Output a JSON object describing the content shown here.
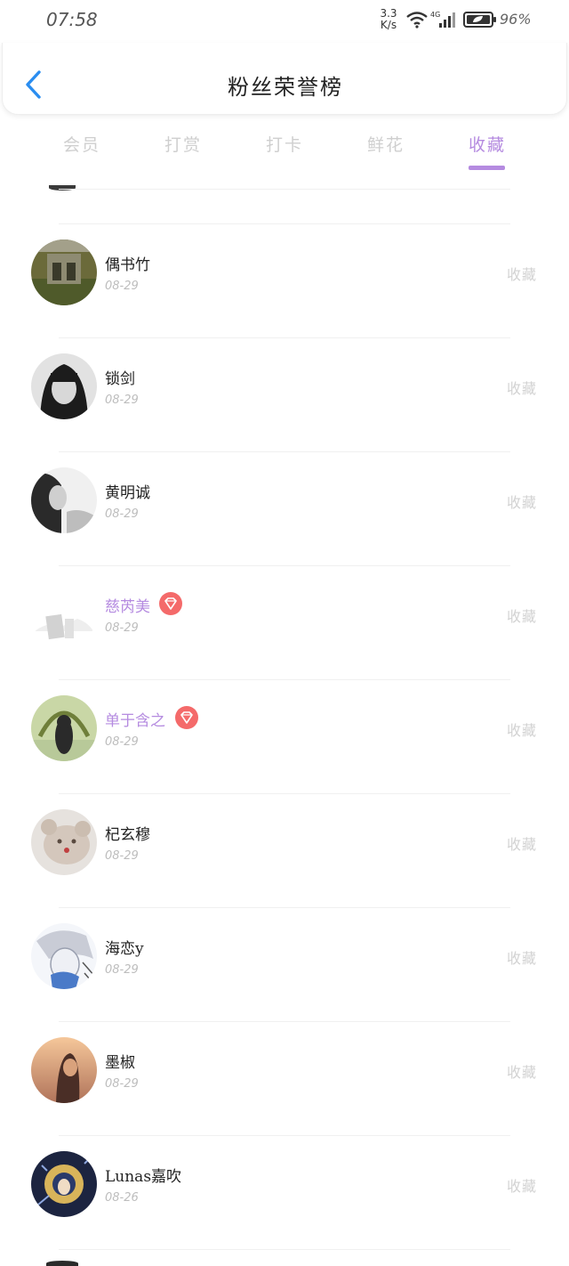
{
  "status": {
    "time": "07:58",
    "net_speed_value": "3.3",
    "net_speed_unit": "K/s",
    "battery": "96%"
  },
  "header": {
    "title": "粉丝荣誉榜"
  },
  "tabs": [
    {
      "label": "会员"
    },
    {
      "label": "打赏"
    },
    {
      "label": "打卡"
    },
    {
      "label": "鲜花"
    },
    {
      "label": "收藏"
    }
  ],
  "active_tab": "收藏",
  "colors": {
    "accent": "#b58be0",
    "back": "#2a8df0",
    "badge": "#f46a6a",
    "muted": "#d2d2d2"
  },
  "rows": [
    {
      "name": "偶书竹",
      "date": "08-29",
      "action": "收藏",
      "vip": false
    },
    {
      "name": "锁剑",
      "date": "08-29",
      "action": "收藏",
      "vip": false
    },
    {
      "name": "黄明诚",
      "date": "08-29",
      "action": "收藏",
      "vip": false
    },
    {
      "name": "慈芮美",
      "date": "08-29",
      "action": "收藏",
      "vip": true
    },
    {
      "name": "单于含之",
      "date": "08-29",
      "action": "收藏",
      "vip": true
    },
    {
      "name": "杞玄穆",
      "date": "08-29",
      "action": "收藏",
      "vip": false
    },
    {
      "name": "海恋y",
      "date": "08-29",
      "action": "收藏",
      "vip": false
    },
    {
      "name": "墨椒",
      "date": "08-29",
      "action": "收藏",
      "vip": false
    },
    {
      "name": "Lunas嘉吹",
      "date": "08-26",
      "action": "收藏",
      "vip": false
    }
  ]
}
